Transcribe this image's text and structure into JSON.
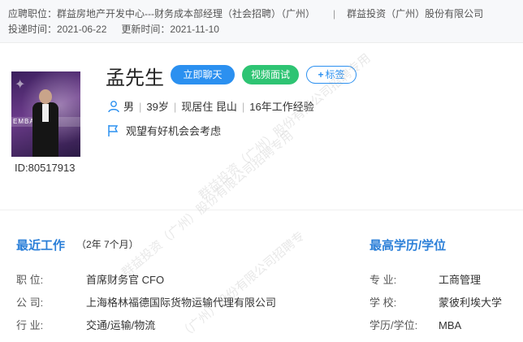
{
  "header": {
    "position_label": "应聘职位：",
    "position_value": "群益房地产开发中心---财务成本部经理（社会招聘）（广州）",
    "separator": "|",
    "company": "群益投资（广州）股份有限公司",
    "applied_label": "投递时间：",
    "applied_value": "2021-06-22",
    "updated_label": "更新时间：",
    "updated_value": "2021-11-10"
  },
  "profile": {
    "photo_text": "EMBA",
    "id_text": "ID:80517913",
    "name": "孟先生",
    "chat_button": "立即聊天",
    "video_button": "视频面试",
    "tag_button": "标签",
    "gender": "男",
    "age": "39岁",
    "residence": "现居住 昆山",
    "experience": "16年工作经验",
    "status": "观望有好机会会考虑"
  },
  "work": {
    "title": "最近工作",
    "duration": "（2年 7个月）",
    "position_label": "职  位:",
    "position_value": "首席财务官 CFO",
    "company_label": "公  司:",
    "company_value": "上海格林福德国际货物运输代理有限公司",
    "industry_label": "行  业:",
    "industry_value": "交通/运输/物流"
  },
  "education": {
    "title": "最高学历/学位",
    "major_label": "专  业:",
    "major_value": "工商管理",
    "school_label": "学  校:",
    "school_value": "蒙彼利埃大学",
    "degree_label": "学历/学位:",
    "degree_value": "MBA"
  },
  "watermark": {
    "line1": "群益投资（广州）股份有限公司招聘专用",
    "line2": "群益投资（广州）股份有限公司招聘专用",
    "line3": "（广州）股份有限公司招聘专"
  },
  "colors": {
    "accent_blue": "#2b90f0",
    "accent_green": "#2ec473",
    "section_title": "#2b7fd8"
  },
  "icons": [
    "user-icon",
    "flag-icon",
    "plus-icon"
  ]
}
